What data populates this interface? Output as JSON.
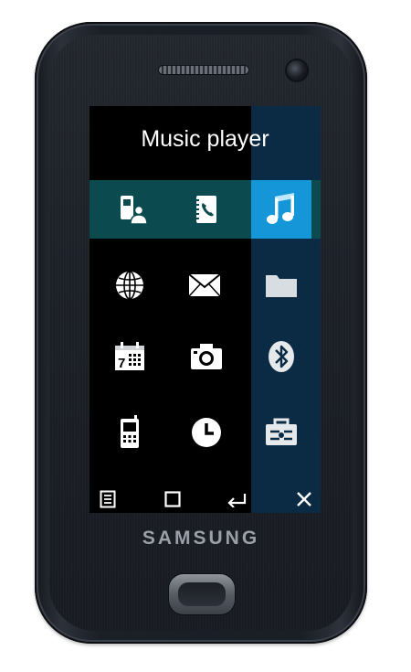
{
  "device": {
    "brand": "SAMSUNG"
  },
  "screen": {
    "title": "Music player",
    "menu": [
      {
        "icon": "contacts-icon",
        "selected": false
      },
      {
        "icon": "phonebook-icon",
        "selected": false
      },
      {
        "icon": "music-note-icon",
        "selected": true
      },
      {
        "icon": "globe-icon",
        "selected": false
      },
      {
        "icon": "envelope-icon",
        "selected": false
      },
      {
        "icon": "folder-icon",
        "selected": false
      },
      {
        "icon": "calendar-icon",
        "selected": false
      },
      {
        "icon": "camera-icon",
        "selected": false
      },
      {
        "icon": "bluetooth-icon",
        "selected": false
      },
      {
        "icon": "phone-icon",
        "selected": false
      },
      {
        "icon": "clock-icon",
        "selected": false
      },
      {
        "icon": "toolbox-icon",
        "selected": false
      }
    ],
    "calendar_day": "7",
    "softkeys": [
      "menu-list-icon",
      "square-icon",
      "back-arrow-icon",
      "close-icon"
    ]
  },
  "colors": {
    "highlight_row": "#0b4a4e",
    "selected_cell": "#1596d8",
    "right_column": "#0b2b45"
  }
}
